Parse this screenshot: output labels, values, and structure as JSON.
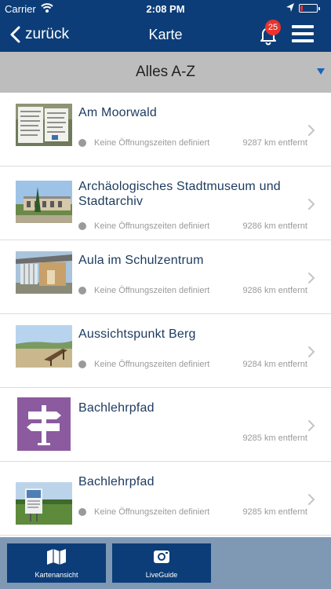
{
  "status_bar": {
    "carrier": "Carrier",
    "time": "2:08 PM",
    "battery_fraction": 0.15
  },
  "nav": {
    "back_label": "zurück",
    "title": "Karte",
    "notification_count": "25"
  },
  "filter": {
    "label": "Alles A-Z"
  },
  "places": [
    {
      "name": "Am Moorwald",
      "hours": "Keine Öffnungszeiten definiert",
      "distance": "9287 km entfernt",
      "thumb": "signpost-photo"
    },
    {
      "name": "Archäologisches Stadtmuseum und Stadtarchiv",
      "hours": "Keine Öffnungszeiten definiert",
      "distance": "9286 km entfernt",
      "thumb": "museum-photo"
    },
    {
      "name": "Aula im Schulzentrum",
      "hours": "Keine Öffnungszeiten definiert",
      "distance": "9286 km entfernt",
      "thumb": "building-photo"
    },
    {
      "name": "Aussichtspunkt Berg",
      "hours": "Keine Öffnungszeiten definiert",
      "distance": "9284 km entfernt",
      "thumb": "viewpoint-photo"
    },
    {
      "name": "Bachlehrpfad",
      "hours": "",
      "distance": "9285 km entfernt",
      "thumb": "signpost-icon"
    },
    {
      "name": "Bachlehrpfad",
      "hours": "Keine Öffnungszeiten definiert",
      "distance": "9285 km entfernt",
      "thumb": "infoboard-photo"
    }
  ],
  "bottom_tabs": [
    {
      "label": "Kartenansicht",
      "icon": "map-icon"
    },
    {
      "label": "LiveGuide",
      "icon": "camera-icon"
    }
  ],
  "colors": {
    "nav_bg": "#0c3d78",
    "filter_bg": "#bdbdbd",
    "title_text": "#1c3a5e",
    "badge": "#e8332e",
    "bottom_bar_bg": "#7f99b4",
    "signpost_tile": "#8c5a9e"
  }
}
